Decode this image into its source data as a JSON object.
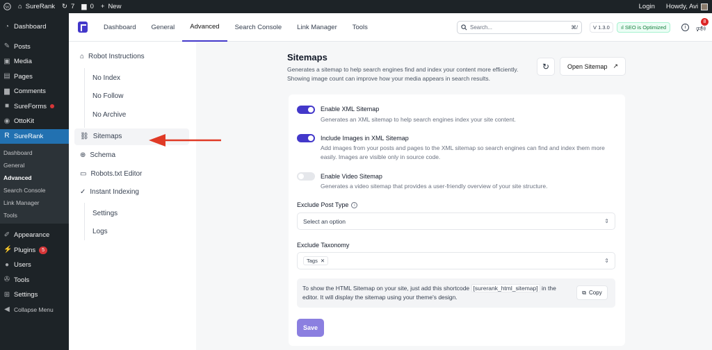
{
  "adminbar": {
    "site": "SureRank",
    "updates": "7",
    "comments": "0",
    "new": "New",
    "login": "Login",
    "howdy": "Howdy, Avi"
  },
  "wp_menu": {
    "dashboard": "Dashboard",
    "posts": "Posts",
    "media": "Media",
    "pages": "Pages",
    "comments": "Comments",
    "sureforms": "SureForms",
    "ottokit": "OttoKit",
    "surerank": "SureRank",
    "submenu": [
      "Dashboard",
      "General",
      "Advanced",
      "Search Console",
      "Link Manager",
      "Tools"
    ],
    "appearance": "Appearance",
    "plugins": "Plugins",
    "plugins_count": "5",
    "users": "Users",
    "tools": "Tools",
    "settings": "Settings",
    "collapse": "Collapse Menu"
  },
  "topnav": {
    "tabs": [
      "Dashboard",
      "General",
      "Advanced",
      "Search Console",
      "Link Manager",
      "Tools"
    ],
    "search_placeholder": "Search...",
    "shortcut": "⌘/",
    "version": "V 1.3.0",
    "seo_status": "SEO is Optimized",
    "notifications": "8"
  },
  "sidebar": {
    "robot": "Robot Instructions",
    "noindex": "No Index",
    "nofollow": "No Follow",
    "noarchive": "No Archive",
    "sitemaps": "Sitemaps",
    "schema": "Schema",
    "robots": "Robots.txt Editor",
    "indexing": "Instant Indexing",
    "settings": "Settings",
    "logs": "Logs"
  },
  "page": {
    "title": "Sitemaps",
    "desc": "Generates a sitemap to help search engines find and index your content more efficiently. Showing image count can improve how your media appears in search results.",
    "open_sitemap": "Open Sitemap",
    "xml_label": "Enable XML Sitemap",
    "xml_desc": "Generates an XML sitemap to help search engines index your site content.",
    "img_label": "Include Images in XML Sitemap",
    "img_desc": "Add images from your posts and pages to the XML sitemap so search engines can find and index them more easily. Images are visible only in source code.",
    "video_label": "Enable Video Sitemap",
    "video_desc": "Generates a video sitemap that provides a user-friendly overview of your site structure.",
    "exclude_post": "Exclude Post Type",
    "post_placeholder": "Select an option",
    "exclude_tax": "Exclude Taxonomy",
    "tax_chip": "Tags",
    "notice_a": "To show the HTML Sitemap on your site, just add this shortcode",
    "notice_code": "[surerank_html_sitemap]",
    "notice_b": "in the editor. It will display the sitemap using your theme's design.",
    "copy": "Copy",
    "save": "Save"
  }
}
